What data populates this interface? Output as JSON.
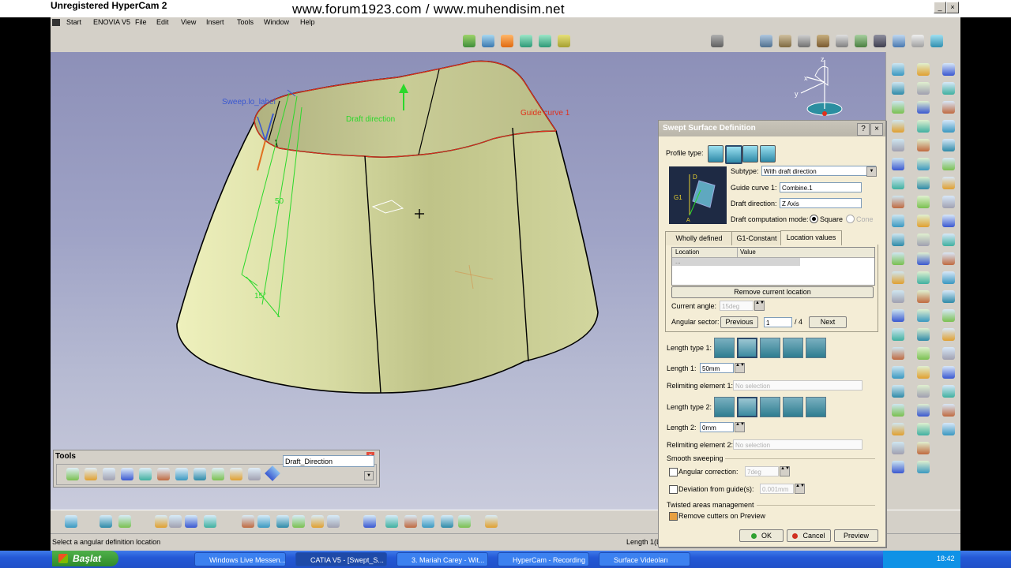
{
  "window": {
    "title": "Unregistered HyperCam 2",
    "watermark": "www.forum1923.com / www.muhendisim.net"
  },
  "menu": {
    "items": [
      "Start",
      "ENOVIA V5",
      "File",
      "Edit",
      "View",
      "Insert",
      "Tools",
      "Window",
      "Help"
    ]
  },
  "viewport": {
    "labels": {
      "sweep_label": "Sweep.lo_label",
      "draft_direction": "Draft direction",
      "guide_curve": "Guide curve 1",
      "angle_50": "50",
      "angle_15": "15°"
    }
  },
  "dialog": {
    "title": "Swept Surface Definition",
    "profile_type_label": "Profile type:",
    "subtype_label": "Subtype:",
    "subtype_value": "With draft direction",
    "guide_curve_label": "Guide curve 1:",
    "guide_curve_value": "Combine.1",
    "draft_direction_label": "Draft direction:",
    "draft_direction_value": "Z Axis",
    "draft_mode_label": "Draft computation mode:",
    "draft_mode_square": "Square",
    "draft_mode_cone": "Cone",
    "tabs": [
      "Wholly defined",
      "G1-Constant",
      "Location values"
    ],
    "table_headers": [
      "Location",
      "Value"
    ],
    "table_rows": [
      [
        "...",
        ""
      ]
    ],
    "remove_location_label": "Remove current location",
    "current_angle_label": "Current angle:",
    "current_angle_value": "15deg",
    "angular_sector_label": "Angular sector:",
    "previous_label": "Previous",
    "sector_value": "1",
    "sector_total": "/ 4",
    "next_label": "Next",
    "length_type1_label": "Length type 1:",
    "length1_label": "Length 1:",
    "length1_value": "50mm",
    "relimiting1_label": "Relimiting element 1:",
    "relimiting1_value": "No selection",
    "length_type2_label": "Length type 2:",
    "length2_label": "Length 2:",
    "length2_value": "0mm",
    "relimiting2_label": "Relimiting element 2:",
    "relimiting2_value": "No selection",
    "smooth_sweeping_label": "Smooth sweeping",
    "angular_correction_label": "Angular correction:",
    "angular_correction_value": "7deg",
    "deviation_label": "Deviation from guide(s):",
    "deviation_value": "0.001mm",
    "twisted_label": "Twisted areas management",
    "remove_cutters_label": "Remove cutters on Preview",
    "ok_label": "OK",
    "cancel_label": "Cancel",
    "preview_label": "Preview"
  },
  "tools": {
    "title": "Tools",
    "combo_value": "Draft_Direction"
  },
  "status": {
    "message": "Select a angular definition location",
    "length_readout": "Length 1(L"
  },
  "taskbar": {
    "start_label": "Başlat",
    "tasks": [
      "Windows Live Messen...",
      "CATIA V5 - [Swept_S...",
      "3. Mariah Carey - Wit...",
      "HyperCam - Recording",
      "Surface Videoları"
    ],
    "clock": "18:42"
  },
  "colors": {
    "surface": "#d4d89a",
    "viewport_top": "#8d90b8",
    "dialog_bg": "#f4edd6",
    "construction_green": "#2bd82b",
    "guide_red": "#e0301c"
  }
}
